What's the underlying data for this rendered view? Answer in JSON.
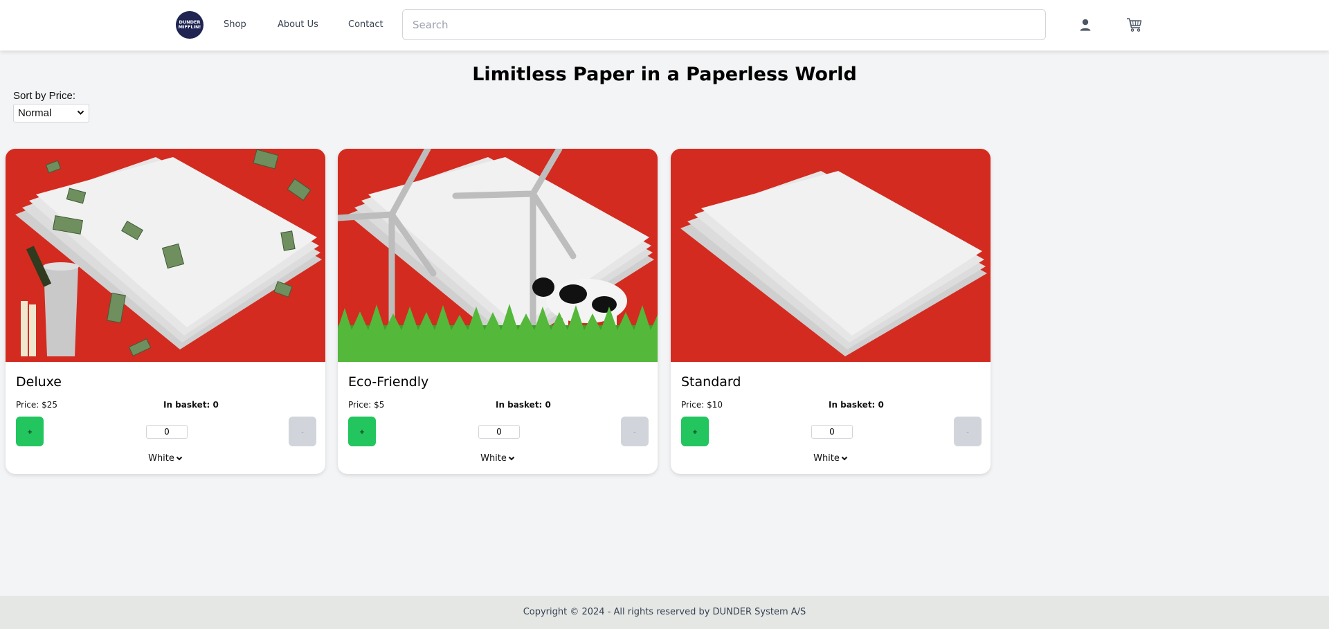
{
  "navbar": {
    "logo": {
      "line1": "DUNDER",
      "line2": "MIFFLIN!"
    },
    "links": [
      {
        "label": "Shop"
      },
      {
        "label": "About Us"
      },
      {
        "label": "Contact"
      }
    ],
    "search_placeholder": "Search",
    "user_icon": "user-icon",
    "cart_icon": "cart-icon"
  },
  "page": {
    "title": "Limitless Paper in a Paperless World",
    "sort_label": "Sort by Price:",
    "sort_value": "Normal"
  },
  "products": [
    {
      "name": "Deluxe",
      "price": "Price: $25",
      "basket": "In basket: 0",
      "plus": "+",
      "minus": "-",
      "qty": "0",
      "color": "White"
    },
    {
      "name": "Eco-Friendly",
      "price": "Price: $5",
      "basket": "In basket: 0",
      "plus": "+",
      "minus": "-",
      "qty": "0",
      "color": "White"
    },
    {
      "name": "Standard",
      "price": "Price: $10",
      "basket": "In basket: 0",
      "plus": "+",
      "minus": "-",
      "qty": "0",
      "color": "White"
    }
  ],
  "footer": {
    "text": "Copyright © 2024 - All rights reserved by DUNDER System A/S"
  },
  "colors": {
    "brand_navy": "#1f2452",
    "accent_green": "#22c55e",
    "product_red": "#d42b20"
  }
}
